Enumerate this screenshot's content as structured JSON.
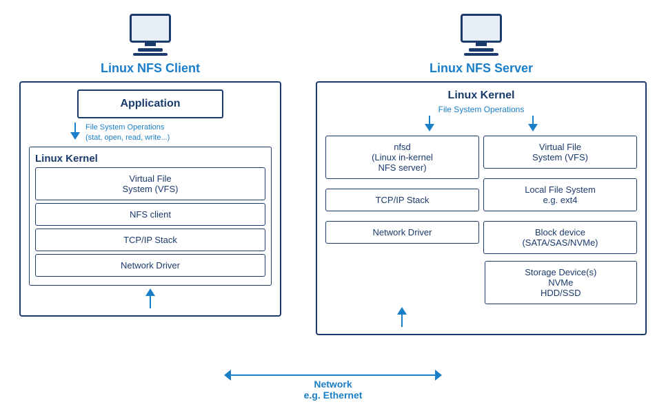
{
  "left": {
    "title": "Linux NFS Client",
    "app_label": "Application",
    "fs_ops_label": "File System Operations\n(stat, open, read, write...)",
    "kernel_label": "Linux Kernel",
    "boxes": [
      "Virtual File\nSystem (VFS)",
      "NFS client",
      "TCP/IP Stack",
      "Network Driver"
    ]
  },
  "right": {
    "title": "Linux NFS Server",
    "kernel_label": "Linux Kernel",
    "fs_ops_label": "File System Operations",
    "boxes_left": [
      "nfsd\n(Linux in-kernel\nNFS server)",
      "TCP/IP Stack",
      "Network Driver"
    ],
    "boxes_right": [
      "Virtual File\nSystem (VFS)",
      "Local File System\ne.g. ext4",
      "Block device\n(SATA/SAS/NVMe)"
    ],
    "storage_label": "Storage Device(s)\nNVMe\nHDD/SSD"
  },
  "network": {
    "label": "Network\ne.g. Ethernet"
  }
}
